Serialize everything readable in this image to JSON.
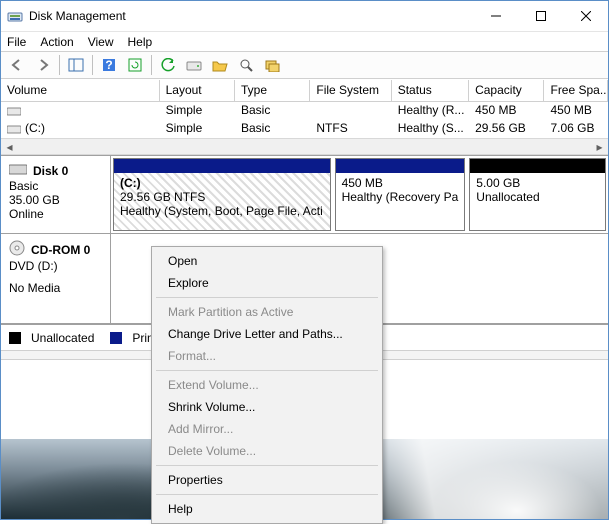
{
  "titlebar": {
    "title": "Disk Management"
  },
  "menubar": {
    "file": "File",
    "action": "Action",
    "view": "View",
    "help": "Help"
  },
  "vol_headers": {
    "c0": "Volume",
    "c1": "Layout",
    "c2": "Type",
    "c3": "File System",
    "c4": "Status",
    "c5": "Capacity",
    "c6": "Free Spa..."
  },
  "volumes": [
    {
      "name": "",
      "layout": "Simple",
      "type": "Basic",
      "fs": "",
      "status": "Healthy (R...",
      "capacity": "450 MB",
      "free": "450 MB"
    },
    {
      "name": "(C:)",
      "layout": "Simple",
      "type": "Basic",
      "fs": "NTFS",
      "status": "Healthy (S...",
      "capacity": "29.56 GB",
      "free": "7.06 GB"
    }
  ],
  "disk0": {
    "name": "Disk 0",
    "type": "Basic",
    "size": "35.00 GB",
    "state": "Online",
    "parts": [
      {
        "title": "(C:)",
        "line2": "29.56 GB NTFS",
        "line3": "Healthy (System, Boot, Page File, Acti"
      },
      {
        "title": "",
        "line2": "450 MB",
        "line3": "Healthy (Recovery Pa"
      },
      {
        "title": "",
        "line2": "5.00 GB",
        "line3": "Unallocated"
      }
    ]
  },
  "cdrom": {
    "name": "CD-ROM 0",
    "type": "DVD (D:)",
    "state": "No Media"
  },
  "legend": {
    "unalloc": "Unallocated",
    "primary": "Prim"
  },
  "ctx": {
    "open": "Open",
    "explore": "Explore",
    "mark": "Mark Partition as Active",
    "change": "Change Drive Letter and Paths...",
    "format": "Format...",
    "extend": "Extend Volume...",
    "shrink": "Shrink Volume...",
    "mirror": "Add Mirror...",
    "delete": "Delete Volume...",
    "props": "Properties",
    "help": "Help"
  }
}
